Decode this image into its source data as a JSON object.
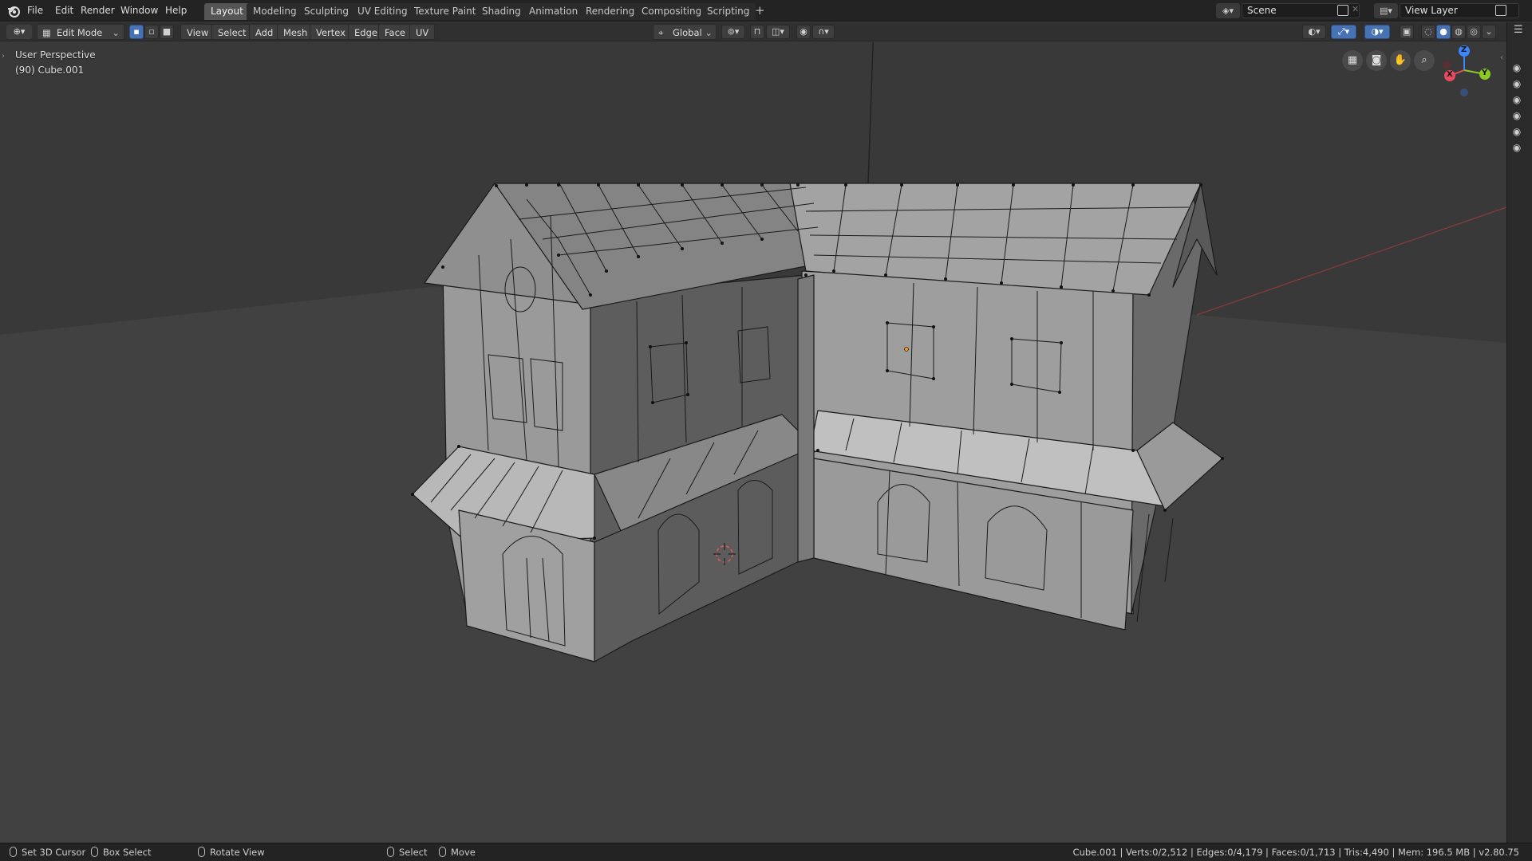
{
  "app": {
    "logo_icon": "blender-logo-icon"
  },
  "menus": [
    "File",
    "Edit",
    "Render",
    "Window",
    "Help"
  ],
  "workspaces": [
    "Layout",
    "Modeling",
    "Sculpting",
    "UV Editing",
    "Texture Paint",
    "Shading",
    "Animation",
    "Rendering",
    "Compositing",
    "Scripting"
  ],
  "active_workspace": "Layout",
  "add_workspace_label": "+",
  "scene": {
    "label": "Scene"
  },
  "view_layer": {
    "label": "View Layer"
  },
  "header": {
    "mode": "Edit Mode",
    "menus": [
      "View",
      "Select",
      "Add",
      "Mesh",
      "Vertex",
      "Edge",
      "Face",
      "UV"
    ],
    "transform_orientation": "Global",
    "select_mode": "vertex"
  },
  "viewport": {
    "perspective_label": "User Perspective",
    "object_label": "(90) Cube.001",
    "axes": {
      "x": "X",
      "y": "Y",
      "z": "Z"
    },
    "colors": {
      "x_axis": "#e84a5f",
      "y_axis": "#8ac926",
      "z_axis": "#3a86ff",
      "select": "#4772b3"
    }
  },
  "statusbar": {
    "hints": [
      {
        "icon": "mouse-left-icon",
        "label": "Set 3D Cursor"
      },
      {
        "icon": "mouse-drag-icon",
        "label": "Box Select"
      },
      {
        "icon": "mouse-middle-icon",
        "label": "Rotate View"
      },
      {
        "icon": "mouse-left-icon",
        "label": "Select"
      },
      {
        "icon": "mouse-drag-icon",
        "label": "Move"
      }
    ],
    "stats": "Cube.001 | Verts:0/2,512 | Edges:0/4,179 | Faces:0/1,713 | Tris:4,490 | Mem: 196.5 MB | v2.80.75"
  }
}
